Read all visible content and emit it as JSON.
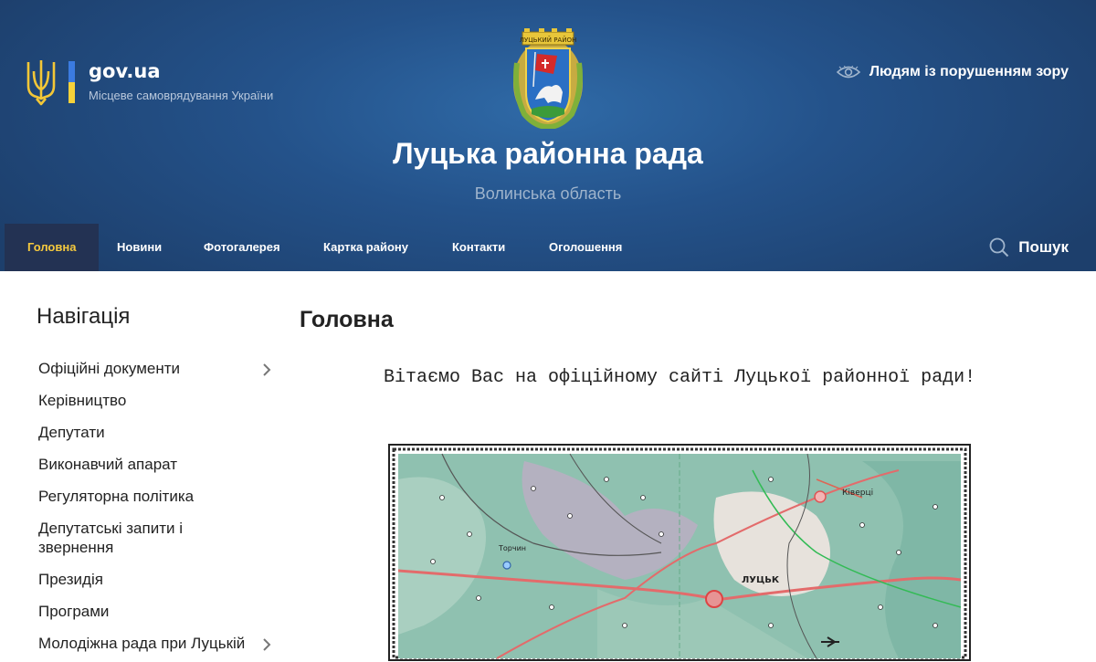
{
  "header": {
    "gov_title": "gov.ua",
    "gov_subtitle": "Місцеве самоврядування України",
    "site_title": "Луцька районна рада",
    "site_subtitle": "Волинська область",
    "accessibility_label": "Людям із порушенням зору",
    "coat_of_arms_text": "ЛУЦЬКИЙ РАЙОН"
  },
  "nav": {
    "items": [
      {
        "label": "Головна",
        "active": true
      },
      {
        "label": "Новини"
      },
      {
        "label": "Фотогалерея"
      },
      {
        "label": "Картка району"
      },
      {
        "label": "Контакти"
      },
      {
        "label": "Оголошення"
      }
    ],
    "search_label": "Пошук"
  },
  "sidebar": {
    "title": "Навігація",
    "items": [
      {
        "label": "Офіційні документи",
        "has_children": true
      },
      {
        "label": "Керівництво"
      },
      {
        "label": "Депутати"
      },
      {
        "label": "Виконавчий апарат"
      },
      {
        "label": "Регуляторна політика"
      },
      {
        "label": "Депутатські запити і звернення"
      },
      {
        "label": "Президія"
      },
      {
        "label": "Програми"
      },
      {
        "label": "Молодіжна рада при Луцькій",
        "has_children": true
      }
    ]
  },
  "main": {
    "title": "Головна",
    "welcome": "Вітаємо Вас на офіційному сайті Луцької районної ради!",
    "map_labels": {
      "city": "ЛУЦЬК",
      "kivertsi": "Ківерці",
      "torchyn": "Торчин"
    }
  },
  "colors": {
    "header_bg": "#24528a",
    "nav_active_bg": "#233253",
    "nav_active_text": "#f5c93e",
    "flag_blue": "#3b7be0",
    "flag_yellow": "#f6d23a"
  }
}
